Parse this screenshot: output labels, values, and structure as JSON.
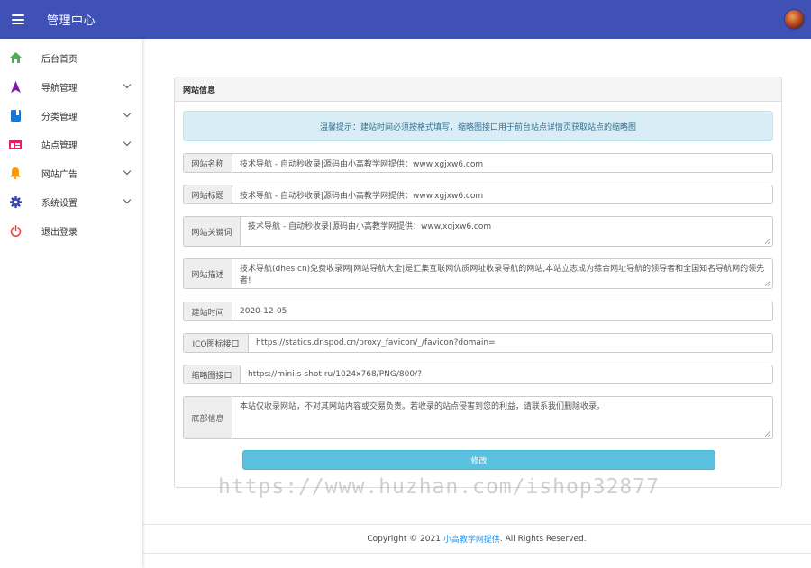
{
  "header": {
    "title": "管理中心",
    "colors": {
      "bar": "#3f51b5"
    }
  },
  "sidebar": {
    "items": [
      {
        "label": "后台首页",
        "icon": "home-icon",
        "color": "#4caf50",
        "has_submenu": false
      },
      {
        "label": "导航管理",
        "icon": "navigation-icon",
        "color": "#7b1fa2",
        "has_submenu": true
      },
      {
        "label": "分类管理",
        "icon": "book-icon",
        "color": "#1976d2",
        "has_submenu": true
      },
      {
        "label": "站点管理",
        "icon": "web-icon",
        "color": "#e91e63",
        "has_submenu": true
      },
      {
        "label": "网站广告",
        "icon": "bell-icon",
        "color": "#ff9800",
        "has_submenu": true
      },
      {
        "label": "系统设置",
        "icon": "gear-icon",
        "color": "#3949ab",
        "has_submenu": true
      },
      {
        "label": "退出登录",
        "icon": "power-icon",
        "color": "#f44336",
        "has_submenu": false
      }
    ]
  },
  "panel": {
    "title": "网站信息",
    "alert": "温馨提示：建站时间必须按格式填写，缩略图接口用于前台站点详情页获取站点的缩略图",
    "fields": [
      {
        "label": "网站名称",
        "value": "技术导航 - 自动秒收录|源码由小高教学网提供：www.xgjxw6.com"
      },
      {
        "label": "网站标题",
        "value": "技术导航 - 自动秒收录|源码由小高教学网提供：www.xgjxw6.com"
      },
      {
        "label": "网站关键词",
        "value": "技术导航 - 自动秒收录|源码由小高教学网提供：www.xgjxw6.com"
      },
      {
        "label": "网站描述",
        "value": "技术导航(dhes.cn)免费收录网|网站导航大全|是汇集互联网优质网址收录导航的网站,本站立志成为综合网址导航的领导者和全国知名导航网的领先者!"
      },
      {
        "label": "建站时间",
        "value": "2020-12-05"
      },
      {
        "label": "ICO图标接口",
        "value": "https://statics.dnspod.cn/proxy_favicon/_/favicon?domain="
      },
      {
        "label": "缩略图接口",
        "value": "https://mini.s-shot.ru/1024x768/PNG/800/?"
      },
      {
        "label": "底部信息",
        "value": "本站仅收录网站，不对其网站内容或交易负责。若收录的站点侵害到您的利益，请联系我们删除收录。"
      }
    ],
    "submit": "修改"
  },
  "footer": {
    "prefix": "Copyright © 2021",
    "link": "小高教学网提供",
    "suffix": ". All Rights Reserved."
  },
  "watermark": "https://www.huzhan.com/ishop32877"
}
